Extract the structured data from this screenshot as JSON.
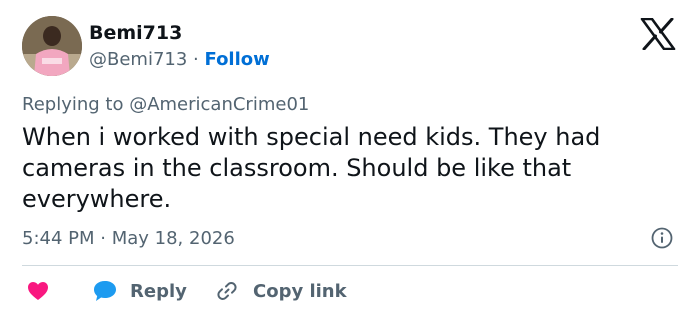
{
  "author": {
    "display_name": "Bemi713",
    "handle": "@Bemi713",
    "separator": " · ",
    "follow_label": "Follow"
  },
  "reply_context": {
    "prefix": "Replying to ",
    "mention": "@AmericanCrime01"
  },
  "tweet": {
    "text": "When i worked with special need kids. They had cameras in the classroom. Should be like that everywhere."
  },
  "meta": {
    "time": "5:44 PM",
    "separator": " · ",
    "date": "May 18, 2026"
  },
  "actions": {
    "reply_label": "Reply",
    "copy_link_label": "Copy link"
  },
  "icons": {
    "brand": "x-logo-icon",
    "info": "info-icon",
    "like": "heart-icon",
    "reply": "chat-bubble-icon",
    "copy": "link-icon"
  },
  "colors": {
    "text": "#0f1419",
    "secondary": "#536471",
    "link": "#006fd6",
    "heart": "#f91880",
    "reply_bubble": "#1d9bf0",
    "divider": "#cfd9de"
  }
}
